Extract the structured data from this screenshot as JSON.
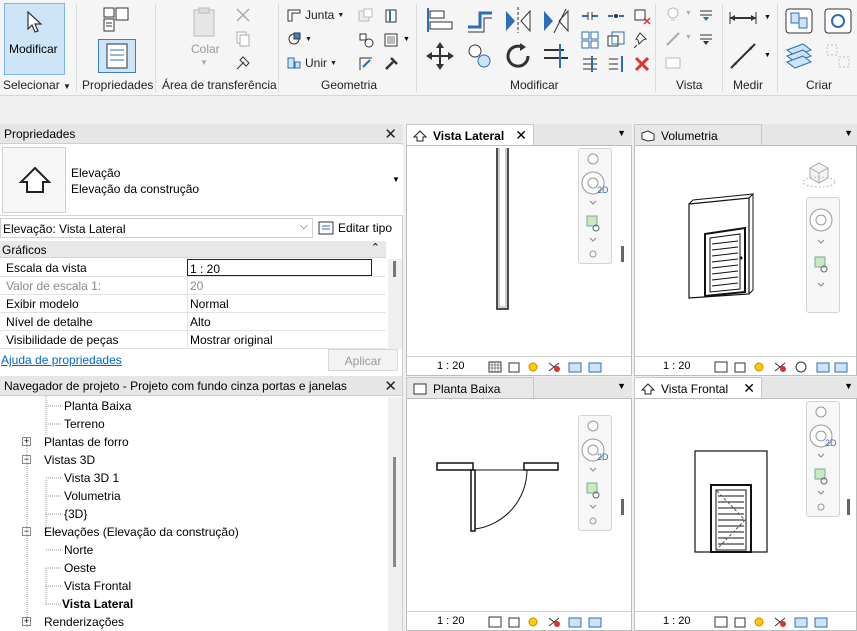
{
  "ribbon": {
    "modify_label": "Modificar",
    "colar_label": "Colar",
    "junta_label": "Junta",
    "unir_label": "Unir",
    "panels": {
      "selecionar": "Selecionar",
      "propriedades": "Propriedades",
      "transferencia": "Área de transferência",
      "geometria": "Geometria",
      "modificar": "Modificar",
      "vista": "Vista",
      "medir": "Medir",
      "criar": "Criar"
    }
  },
  "properties": {
    "title": "Propriedades",
    "type_line1": "Elevação",
    "type_line2": "Elevação da construção",
    "selector_value": "Elevação: Vista Lateral",
    "edit_type_label": "Editar tipo",
    "group_label": "Gráficos",
    "rows": [
      {
        "key": "Escala da vista",
        "value": "1 : 20"
      },
      {
        "key": "Valor de escala    1:",
        "value": "20"
      },
      {
        "key": "Exibir modelo",
        "value": "Normal"
      },
      {
        "key": "Nível de detalhe",
        "value": "Alto"
      },
      {
        "key": "Visibilidade de peças",
        "value": "Mostrar original"
      }
    ],
    "help_link": "Ajuda de propriedades",
    "apply_label": "Aplicar"
  },
  "browser": {
    "title": "Navegador de projeto - Projeto com fundo cinza portas e janelas",
    "items": [
      {
        "label": "Planta Baixa"
      },
      {
        "label": "Terreno"
      },
      {
        "label": "Plantas de forro"
      },
      {
        "label": "Vistas 3D"
      },
      {
        "label": "Vista 3D 1"
      },
      {
        "label": "Volumetria"
      },
      {
        "label": "{3D}"
      },
      {
        "label": "Elevações (Elevação da construção)"
      },
      {
        "label": "Norte"
      },
      {
        "label": "Oeste"
      },
      {
        "label": "Vista Frontal"
      },
      {
        "label": "Vista Lateral"
      },
      {
        "label": "Renderizações"
      }
    ]
  },
  "views": {
    "lateral": {
      "title": "Vista Lateral",
      "scale": "1 : 20"
    },
    "volumetria": {
      "title": "Volumetria",
      "scale": "1 : 20"
    },
    "planta": {
      "title": "Planta Baixa",
      "scale": "1 : 20"
    },
    "frontal": {
      "title": "Vista Frontal",
      "scale": "1 : 20"
    }
  },
  "colors": {
    "accent": "#cde5f7",
    "link": "#0066cc"
  }
}
